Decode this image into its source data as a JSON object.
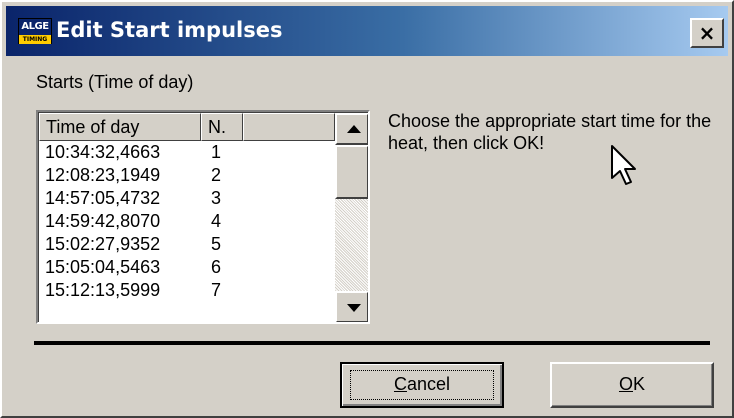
{
  "window": {
    "title": "Edit Start impulses",
    "icon_top_text": "ALGE",
    "icon_bottom_text": "TIMING",
    "close_label": "×"
  },
  "group": {
    "label": "Starts (Time of day)"
  },
  "list": {
    "columns": [
      "Time of day",
      "N.",
      ""
    ],
    "rows": [
      {
        "time": "10:34:32,4663",
        "n": "1"
      },
      {
        "time": "12:08:23,1949",
        "n": "2"
      },
      {
        "time": "14:57:05,4732",
        "n": "3"
      },
      {
        "time": "14:59:42,8070",
        "n": "4"
      },
      {
        "time": "15:02:27,9352",
        "n": "5"
      },
      {
        "time": "15:05:04,5463",
        "n": "6"
      },
      {
        "time": "15:12:13,5999",
        "n": "7"
      }
    ]
  },
  "instruction": "Choose the appropriate start time for the heat, then click OK!",
  "buttons": {
    "cancel_label": "Cancel",
    "cancel_mnemonic": "C",
    "cancel_rest": "ancel",
    "ok_label": "OK",
    "ok_mnemonic": "O",
    "ok_rest": "K"
  },
  "colors": {
    "titlebar_start": "#0a246a",
    "titlebar_end": "#a6caf0",
    "face": "#d4d0c8"
  },
  "icons": [
    "app-logo-icon",
    "close-icon",
    "scroll-up-icon",
    "scroll-down-icon",
    "mouse-cursor-icon"
  ]
}
